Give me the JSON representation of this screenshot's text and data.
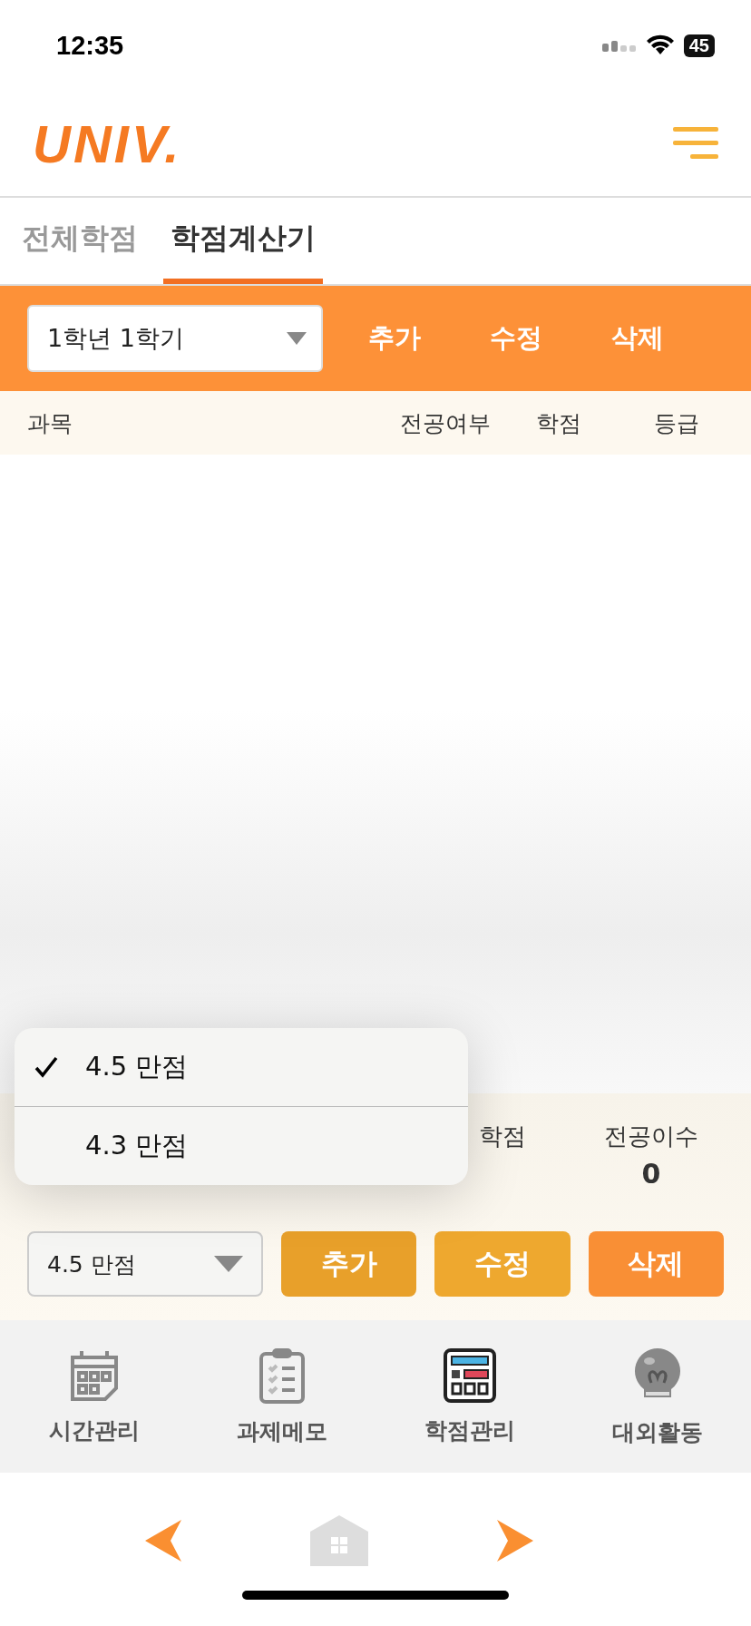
{
  "status_bar": {
    "time": "12:35",
    "battery": "45"
  },
  "header": {
    "logo": "UNIV."
  },
  "tabs": [
    {
      "label": "전체학점",
      "selected": false
    },
    {
      "label": "학점계산기",
      "selected": true
    }
  ],
  "toolbar": {
    "semester": "1학년 1학기",
    "buttons": [
      "추가",
      "수정",
      "삭제"
    ]
  },
  "table": {
    "columns": [
      "과목",
      "전공여부",
      "학점",
      "등급"
    ]
  },
  "summary": {
    "stats": [
      {
        "label": "학점"
      },
      {
        "label": "전공이수",
        "value": "0"
      }
    ]
  },
  "scale_select": {
    "value": "4.5 만점"
  },
  "scale_menu": [
    {
      "label": "4.5 만점",
      "selected": true
    },
    {
      "label": "4.3 만점",
      "selected": false
    }
  ],
  "actions": [
    {
      "label": "추가",
      "color": "#e8a02a"
    },
    {
      "label": "수정",
      "color": "#eea82f"
    },
    {
      "label": "삭제",
      "color": "#f98f35"
    }
  ],
  "nav": [
    {
      "label": "시간관리",
      "kind": "calendar",
      "selected": false
    },
    {
      "label": "과제메모",
      "kind": "clipboard",
      "selected": false
    },
    {
      "label": "학점관리",
      "kind": "calculator",
      "selected": true
    },
    {
      "label": "대외활동",
      "kind": "bulb",
      "selected": false
    }
  ]
}
